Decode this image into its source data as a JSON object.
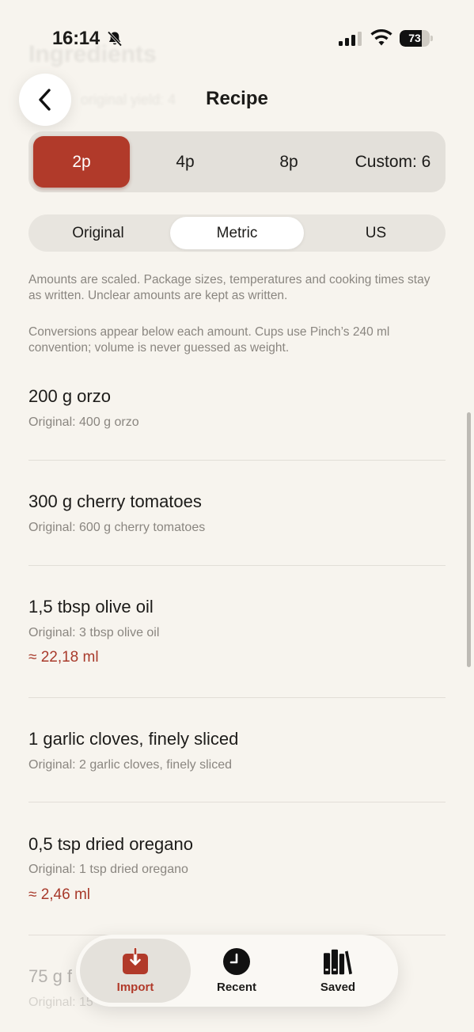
{
  "status_bar": {
    "time": "16:14",
    "battery": "73",
    "battery_level": 0.73
  },
  "ghost": {
    "title": "Ingredients",
    "subtitle": "original yield: 4"
  },
  "header": {
    "title": "Recipe"
  },
  "servings": {
    "options": [
      "2p",
      "4p",
      "8p",
      "Custom: 6"
    ],
    "selected": 0
  },
  "units": {
    "options": [
      "Original",
      "Metric",
      "US"
    ],
    "selected": 1
  },
  "notes": [
    "Amounts are scaled. Package sizes, temperatures and cooking times stay as written. Unclear amounts are kept as written.",
    "Conversions appear below each amount. Cups use Pinch’s 240 ml convention; volume is never guessed as weight."
  ],
  "ingredients": [
    {
      "name": "200 g orzo",
      "original": "Original: 400 g orzo",
      "conversion": ""
    },
    {
      "name": "300 g cherry tomatoes",
      "original": "Original: 600 g cherry tomatoes",
      "conversion": ""
    },
    {
      "name": "1,5 tbsp olive oil",
      "original": "Original: 3 tbsp olive oil",
      "conversion": "≈ 22,18 ml"
    },
    {
      "name": "1 garlic cloves, finely sliced",
      "original": "Original: 2 garlic cloves, finely sliced",
      "conversion": ""
    },
    {
      "name": "0,5 tsp dried oregano",
      "original": "Original: 1 tsp dried oregano",
      "conversion": "≈ 2,46 ml"
    },
    {
      "name": "75 g f",
      "original": "Original: 15",
      "conversion": ""
    }
  ],
  "tab_bar": {
    "tabs": [
      {
        "label": "Import",
        "icon": "import-icon"
      },
      {
        "label": "Recent",
        "icon": "clock-icon"
      },
      {
        "label": "Saved",
        "icon": "books-icon"
      }
    ],
    "active": 0,
    "accent": "#B13A2A"
  }
}
